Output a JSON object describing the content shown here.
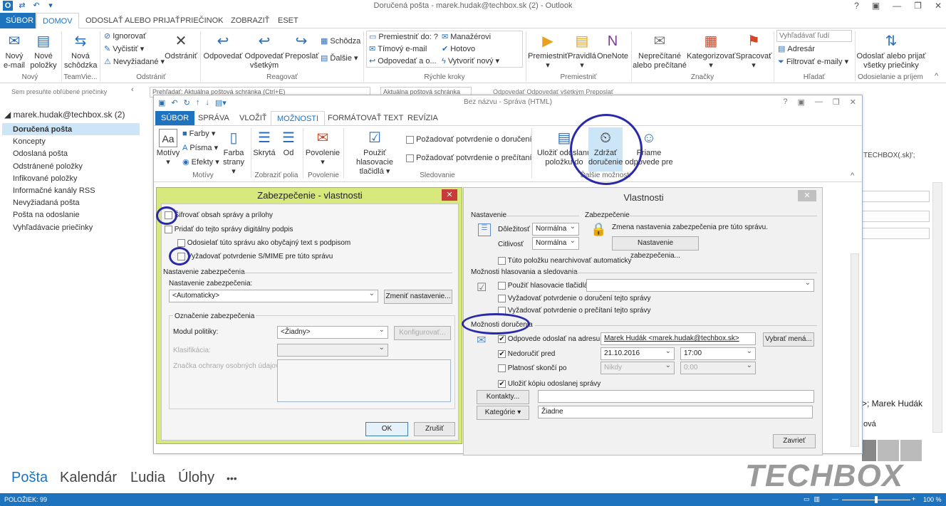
{
  "window": {
    "title": "Doručená pošta - marek.hudak@techbox.sk (2) - Outlook",
    "help": "?"
  },
  "tabs": [
    "SÚBOR",
    "DOMOV",
    "ODOSLAŤ ALEBO PRIJAŤ",
    "PRIEČINOK",
    "ZOBRAZIŤ",
    "ESET"
  ],
  "ribbon": {
    "new_email": "Nový e-mail",
    "new_items": "Nové položky",
    "new_meeting": "Nová schôdzka",
    "ignore": "Ignorovať",
    "clean": "Vyčistiť",
    "junk": "Nevyžiadané",
    "delete": "Odstrániť",
    "reply": "Odpovedať",
    "reply_all": "Odpovedať všetkým",
    "forward": "Preposlať",
    "meeting": "Schôdza",
    "more": "Ďalšie",
    "qs1": "Premiestniť do: ?",
    "qs2": "Manažérovi",
    "qs3": "Tímový e-mail",
    "qs4": "Hotovo",
    "qs5": "Odpovedať a o...",
    "qs6": "Vytvoriť nový",
    "move": "Premiestniť",
    "rules": "Pravidlá",
    "onenote": "OneNote",
    "unread": "Neprečítané alebo prečítané",
    "categorize": "Kategorizovať",
    "followup": "Spracovať",
    "search_people": "Vyhľadávať ľudí",
    "addressbook": "Adresár",
    "filter": "Filtrovať e-maily",
    "sendrecv": "Odoslať alebo prijať všetky priečinky",
    "groups": {
      "new": "Nový",
      "teamviewer": "TeamVie...",
      "delete": "Odstrániť",
      "respond": "Reagovať",
      "quick": "Rýchle kroky",
      "move": "Premiestniť",
      "tags": "Značky",
      "find": "Hľadať",
      "sr": "Odosielanie a príjem"
    }
  },
  "sidebar": {
    "favorites_hint": "Sem presuňte obľúbené priečinky",
    "account": "marek.hudak@techbox.sk (2)",
    "folders": [
      "Doručená pošta",
      "Koncepty",
      "Odoslaná pošta",
      "Odstránené položky",
      "Infikované položky",
      "Informačné kanály RSS",
      "Nevyžiadaná pošta",
      "Pošta na odoslanie",
      "Vyhľadávacie priečinky"
    ]
  },
  "search": {
    "placeholder": "Prehľadať: Aktuálna poštová schránka (Ctrl+E)",
    "scope": "Aktuálna poštová schránka",
    "actions": "Odpovedať   Odpovedať všetkým   Preposlať"
  },
  "nav": {
    "mail": "Pošta",
    "calendar": "Kalendár",
    "people": "Ľudia",
    "tasks": "Úlohy",
    "more": "•••"
  },
  "status": {
    "items": "POLOŽIEK: 99",
    "zoom": "100 %"
  },
  "brand": "TECHBOX",
  "compose": {
    "title": "Bez názvu - Správa (HTML)",
    "tabs": [
      "SÚBOR",
      "SPRÁVA",
      "VLOŽIŤ",
      "MOŽNOSTI",
      "FORMÁTOVAŤ TEXT",
      "REVÍZIA"
    ],
    "themes": "Motívy",
    "colors": "Farby",
    "fonts": "Písma",
    "effects": "Efekty",
    "page_color": "Farba strany",
    "bcc": "Skrytá",
    "from": "Od",
    "permission": "Povolenie",
    "voting": "Použiť hlasovacie tlačidlá",
    "req_delivery": "Požadovať potvrdenie o doručení",
    "req_read": "Požadovať potvrdenie o prečítaní",
    "save_sent": "Uložiť odoslanú položku do",
    "delay": "Zdržať doručenie",
    "direct_replies": "Priame odpovede pre",
    "grp_themes": "Motívy",
    "grp_fields": "Zobraziť polia",
    "grp_perm": "Povolenie",
    "grp_track": "Sledovanie",
    "grp_more": "Ďalšie možnosti"
  },
  "security": {
    "title": "Zabezpečenie - vlastnosti",
    "encrypt": "Šifrovať obsah správy a prílohy",
    "sign": "Pridať do tejto správy digitálny podpis",
    "cleartext": "Odosielať túto správu ako obyčajný text s podpisom",
    "smime": "Vyžadovať potvrdenie S/MIME pre túto správu",
    "settings_group": "Nastavenie zabezpečenia",
    "settings_label": "Nastavenie zabezpečenia:",
    "settings_value": "<Automaticky>",
    "change_btn": "Zmeniť nastavenie...",
    "label_group": "Označenie zabezpečenia",
    "policy_label": "Modul politiky:",
    "policy_value": "<Žiadny>",
    "configure_btn": "Konfigurovať...",
    "classification": "Klasifikácia:",
    "privacy": "Značka ochrany osobných údajov:",
    "ok": "OK",
    "cancel": "Zrušiť"
  },
  "props": {
    "title": "Vlastnosti",
    "settings": "Nastavenie",
    "security": "Zabezpečenie",
    "importance_label": "Dôležitosť",
    "importance": "Normálna",
    "sensitivity_label": "Citlivosť",
    "sensitivity": "Normálna",
    "sec_text": "Zmena nastavenia zabezpečenia pre túto správu.",
    "sec_btn": "Nastavenie zabezpečenia...",
    "no_archive": "Túto položku nearchivovať automaticky",
    "voting_group": "Možnosti hlasovania a sledovania",
    "use_voting": "Použiť hlasovacie tlačidlá",
    "req_delivery": "Vyžadovať potvrdenie o doručení tejto správy",
    "req_read": "Vyžadovať potvrdenie o prečítaní tejto správy",
    "delivery_group": "Možnosti doručenia",
    "reply_to": "Odpovede odoslať na adresu",
    "reply_to_value": "Marek Hudák <marek.hudak@techbox.sk>",
    "select_names": "Vybrať mená...",
    "no_deliver": "Nedoručiť pred",
    "date": "21.10.2016",
    "time": "17:00",
    "expires": "Platnosť skončí po",
    "exp_date": "Nikdy",
    "exp_time": "0:00",
    "save_copy": "Uložiť kópiu odoslanej správy",
    "contacts": "Kontakty...",
    "categories": "Kategórie",
    "categories_value": "Žiadne",
    "close": "Zavrieť"
  },
  "behind": {
    "techbox_text": "TECHBOX(.sk)';",
    "name_text": ">; Marek Hudák",
    "ova": "ová"
  }
}
